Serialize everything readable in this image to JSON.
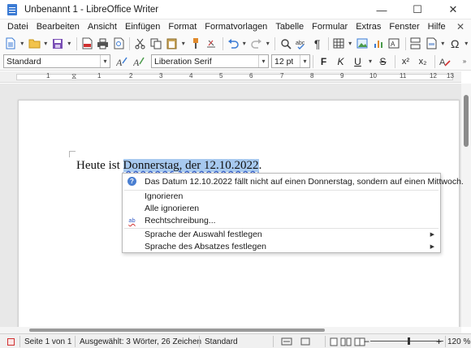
{
  "window": {
    "title": "Unbenannt 1 - LibreOffice Writer",
    "controls": {
      "minimize": "—",
      "maximize": "☐",
      "close": "✕"
    }
  },
  "menubar": {
    "items": [
      "Datei",
      "Bearbeiten",
      "Ansicht",
      "Einfügen",
      "Format",
      "Formatvorlagen",
      "Tabelle",
      "Formular",
      "Extras",
      "Fenster",
      "Hilfe"
    ],
    "close_doc": "✕"
  },
  "toolbar": {
    "icons": [
      "new-document-icon",
      "open-folder-icon",
      "save-icon",
      "export-pdf-icon",
      "print-icon",
      "print-preview-icon",
      "cut-icon",
      "copy-icon",
      "paste-icon",
      "clone-format-icon",
      "undo-icon",
      "redo-icon",
      "find-replace-icon",
      "spellcheck-icon",
      "formatting-marks-icon",
      "insert-table-icon",
      "insert-image-icon",
      "insert-chart-icon",
      "insert-textbox-icon",
      "insert-page-break-icon",
      "insert-field-icon",
      "special-character-icon"
    ]
  },
  "formatting": {
    "paragraph_style": "Standard",
    "font_name": "Liberation Serif",
    "font_size": "12 pt",
    "bold": "F",
    "italic": "K",
    "underline": "U",
    "strikethrough": "S",
    "superscript": "x²",
    "subscript": "x₂"
  },
  "ruler": {
    "numbers": [
      "1",
      "1",
      "2",
      "3",
      "4",
      "5",
      "6",
      "7",
      "8",
      "9",
      "10",
      "11",
      "12",
      "13"
    ]
  },
  "document": {
    "text_before": "Heute ist ",
    "text_selected": "Donnerstag, der 12.10.2022",
    "text_after": "."
  },
  "context_menu": {
    "info": "Das Datum 12.10.2022 fällt nicht auf einen Donnerstag, sondern auf einen Mittwoch.",
    "ignore": "Ignorieren",
    "ignore_all": "Alle ignorieren",
    "spelling": "Rechtschreibung...",
    "selection_language": "Sprache der Auswahl festlegen",
    "paragraph_language": "Sprache des Absatzes festlegen"
  },
  "statusbar": {
    "page": "Seite 1 von 1",
    "selection": "Ausgewählt: 3 Wörter, 26 Zeichen",
    "page_style": "Standard",
    "zoom": "120 %",
    "zoom_minus": "−",
    "zoom_plus": "+"
  },
  "colors": {
    "selection": "#a7c9ef",
    "grammar_underline": "#3a62c9",
    "accent": "#3b7bd4"
  }
}
